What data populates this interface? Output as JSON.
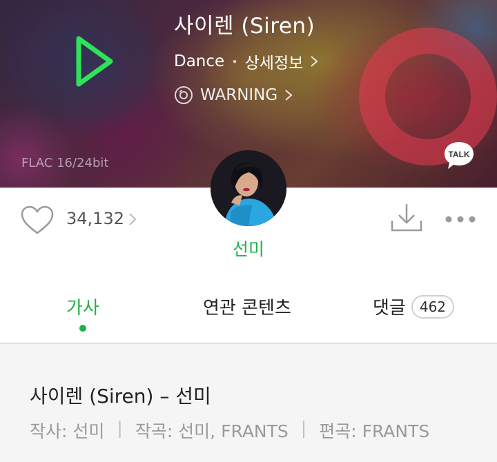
{
  "song": {
    "title": "사이렌 (Siren)",
    "genre": "Dance",
    "detail_link": "상세정보",
    "album": "WARNING",
    "quality": "FLAC 16/24bit"
  },
  "talk_badge": "TALK",
  "likes": {
    "count": "34,132"
  },
  "artist": {
    "name": "선미"
  },
  "tabs": [
    {
      "label": "가사",
      "active": true
    },
    {
      "label": "연관 콘텐츠",
      "active": false
    },
    {
      "label": "댓글",
      "active": false,
      "badge": "462"
    }
  ],
  "lyrics_info": {
    "heading": "사이렌 (Siren) – 선미",
    "lyricist": "작사: 선미",
    "composer": "작곡: 선미, FRANTS",
    "arranger": "편곡: FRANTS",
    "separator": "|"
  },
  "colors": {
    "accent": "#22b04a",
    "text_dark": "#222222",
    "text_muted": "#9a9a9a"
  },
  "icons": [
    "play-icon",
    "chevron-right-icon",
    "disc-icon",
    "talk-icon",
    "heart-icon",
    "download-icon",
    "more-icon"
  ]
}
